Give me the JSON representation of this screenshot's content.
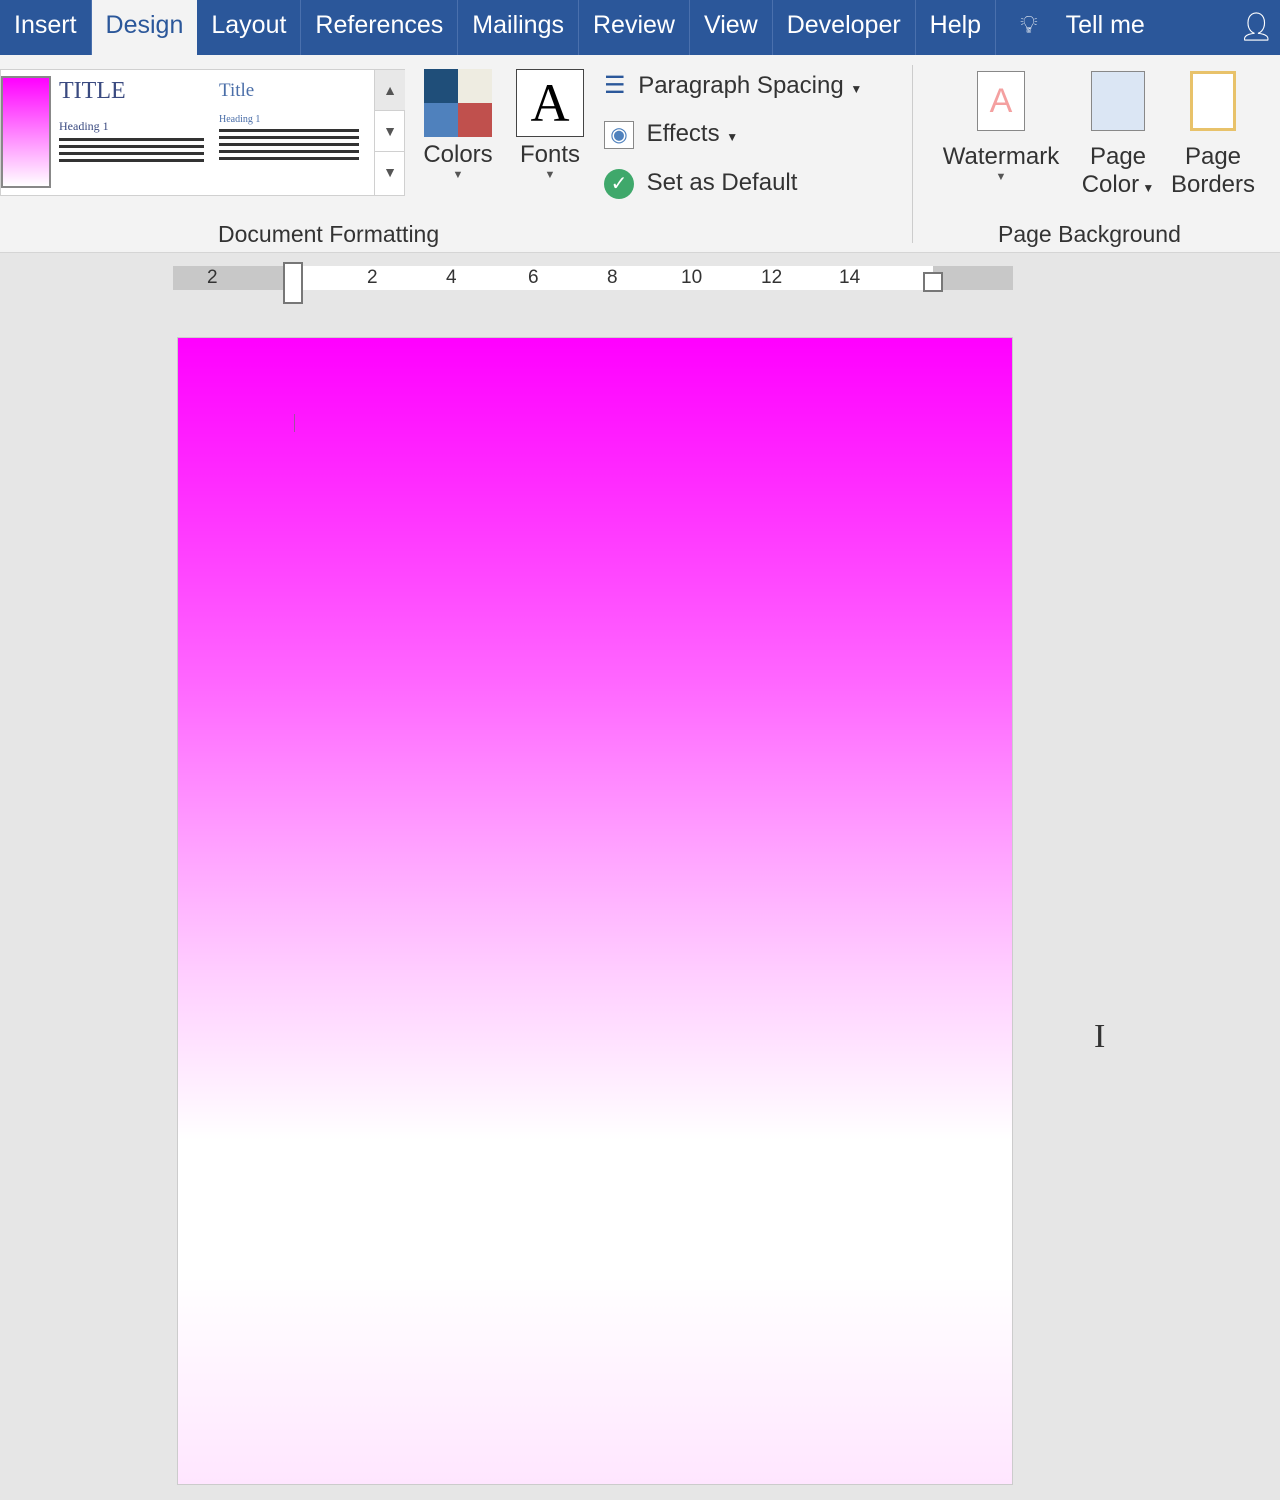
{
  "tabs": [
    "Insert",
    "Design",
    "Layout",
    "References",
    "Mailings",
    "Review",
    "View",
    "Developer",
    "Help"
  ],
  "active_tab": "Design",
  "tell_me": "Tell me",
  "gallery": {
    "theme1_title": "TITLE",
    "theme1_heading": "Heading 1",
    "theme2_title": "Title",
    "theme2_heading": "Heading 1"
  },
  "doc_formatting": {
    "colors": "Colors",
    "fonts": "Fonts",
    "fonts_glyph": "A",
    "paragraph_spacing": "Paragraph Spacing",
    "effects": "Effects",
    "set_default": "Set as Default",
    "group_label": "Document Formatting"
  },
  "page_background": {
    "watermark": "Watermark",
    "page_color_1": "Page",
    "page_color_2": "Color",
    "page_borders_1": "Page",
    "page_borders_2": "Borders",
    "group_label": "Page Background"
  },
  "ruler": [
    "2",
    "2",
    "4",
    "6",
    "8",
    "10",
    "12",
    "14"
  ],
  "colors": {
    "tab_bar": "#2b579a",
    "page_color_top": "#ff00ff",
    "page_color_bottom": "#ffffff"
  }
}
